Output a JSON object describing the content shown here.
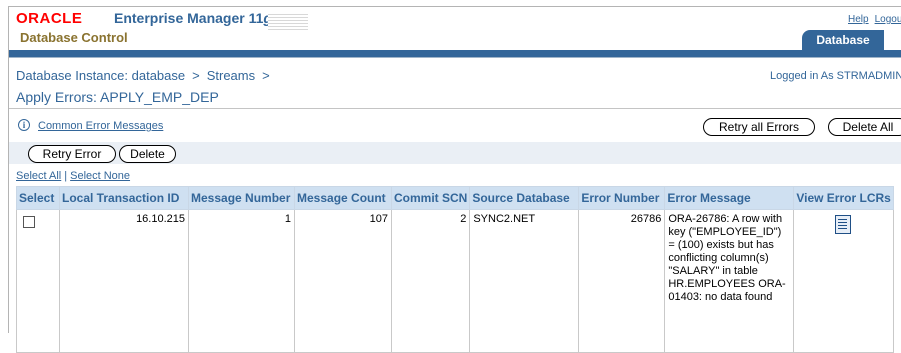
{
  "header": {
    "brand": "ORACLE",
    "product": "Enterprise Manager 11",
    "version_suffix": "g",
    "subtitle": "Database Control",
    "help_link": "Help",
    "logout_link": "Logout",
    "active_tab": "Database"
  },
  "breadcrumb": {
    "items": [
      "Database Instance: database",
      "Streams"
    ],
    "separator": ">"
  },
  "login_status": "Logged in As STRMADMIN",
  "page_title": "Apply Errors: APPLY_EMP_DEP",
  "help_link_text": "Common Error Messages",
  "buttons": {
    "retry_all": "Retry all Errors",
    "delete_all": "Delete All",
    "retry": "Retry Error",
    "delete": "Delete"
  },
  "select_links": {
    "select_all": "Select All",
    "select_none": "Select None"
  },
  "table": {
    "headers": [
      "Select",
      "Local Transaction ID",
      "Message Number",
      "Message Count",
      "Commit SCN",
      "Source Database",
      "Error Number",
      "Error Message",
      "View Error LCRs"
    ],
    "rows": [
      {
        "selected": false,
        "transaction_id": "16.10.215",
        "message_number": "1",
        "message_count": "107",
        "commit_scn": "2",
        "source_database": "SYNC2.NET",
        "error_number": "26786",
        "error_message": "ORA-26786: A row with key (\"EMPLOYEE_ID\") = (100) exists but has conflicting column(s) \"SALARY\" in table HR.EMPLOYEES ORA-01403: no data found"
      }
    ]
  },
  "colors": {
    "brand_red": "#ff0000",
    "link_blue": "#336699",
    "header_bg": "#cfe0f1",
    "gold_text": "#8a7330"
  }
}
